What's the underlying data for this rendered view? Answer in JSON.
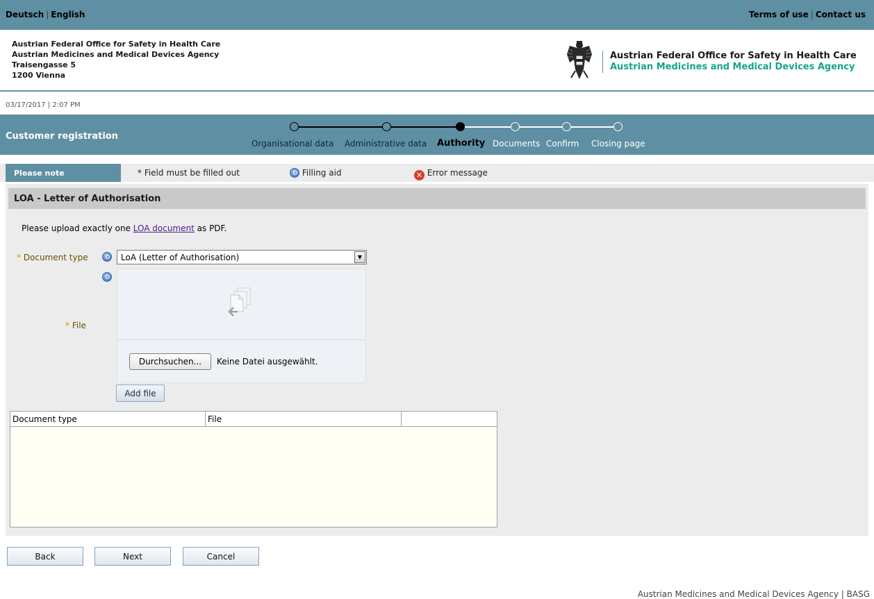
{
  "topbar": {
    "lang_de": "Deutsch",
    "lang_sep": "|",
    "lang_en": "English",
    "terms": "Terms of use",
    "links_sep": "|",
    "contact": "Contact us"
  },
  "header": {
    "address": [
      "Austrian Federal Office for Safety in Health Care",
      "Austrian Medicines and Medical Devices Agency",
      "Traisengasse 5",
      "1200 Vienna"
    ],
    "logo_line1": "Austrian Federal Office for Safety in Health Care",
    "logo_line2": "Austrian Medicines and Medical Devices Agency",
    "logo_icon": "austrian-eagle-icon"
  },
  "datetime": "03/17/2017 | 2:07 PM",
  "registration": {
    "title": "Customer registration",
    "steps": [
      "Organisational data",
      "Administrative data",
      "Authority",
      "Documents",
      "Confirm",
      "Closing page"
    ],
    "current_step": "Authority"
  },
  "note": {
    "title": "Please note",
    "required": "* Field must be filled out",
    "filling_aid": "Filling aid",
    "error": "Error message"
  },
  "section": {
    "title": "LOA - Letter of Authorisation",
    "intro_before": "Please upload exactly one ",
    "intro_link": "LOA document",
    "intro_after": " as PDF."
  },
  "form": {
    "doc_type_req": "*",
    "doc_type_label": "Document type",
    "doc_type_value": "LoA (Letter of Authorisation)",
    "file_req": "*",
    "file_label": "File",
    "browse_label": "Durchsuchen...",
    "no_file": "Keine Datei ausgewählt.",
    "add_file": "Add file"
  },
  "grid": {
    "columns": [
      "Document type",
      "File",
      ""
    ]
  },
  "nav": {
    "back": "Back",
    "next": "Next",
    "cancel": "Cancel"
  },
  "footer": "Austrian Medicines and Medical Devices Agency | BASG",
  "colors": {
    "brand_bar": "#5f8fa3",
    "agency_green": "#17a589",
    "panel_bg": "#ececec"
  }
}
